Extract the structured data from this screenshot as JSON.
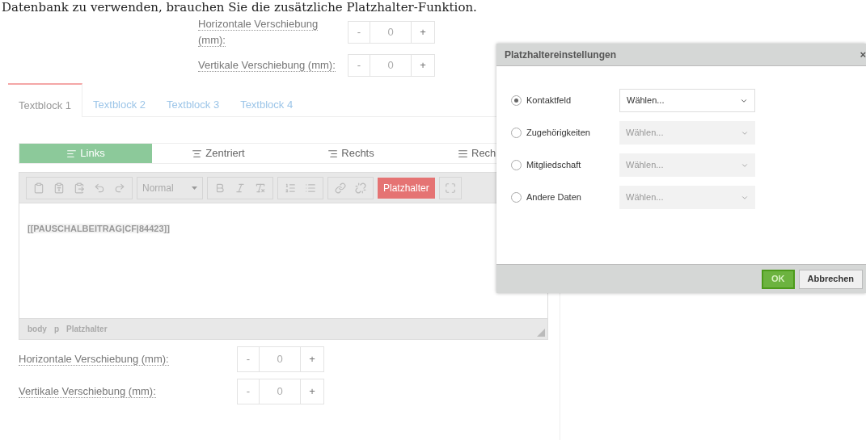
{
  "intro_text": "Datenbank zu verwenden, brauchen Sie die zusätzliche Platzhalter-Funktion.",
  "top_offsets": [
    {
      "label": "Horizontale Verschiebung (mm):",
      "minus": "-",
      "value": "0",
      "plus": "+"
    },
    {
      "label": "Vertikale Verschiebung (mm):",
      "minus": "-",
      "value": "0",
      "plus": "+"
    }
  ],
  "tabs": [
    {
      "label": "Textblock 1",
      "selected": true
    },
    {
      "label": "Textblock 2",
      "selected": false
    },
    {
      "label": "Textblock 3",
      "selected": false
    },
    {
      "label": "Textblock 4",
      "selected": false
    }
  ],
  "alignment": [
    {
      "label": "Links",
      "kind": "left",
      "selected": true
    },
    {
      "label": "Zentriert",
      "kind": "center",
      "selected": false
    },
    {
      "label": "Rechts",
      "kind": "right",
      "selected": false
    },
    {
      "label": "Rech",
      "kind": "justify",
      "selected": false
    }
  ],
  "toolbar": {
    "format": "Normal",
    "placeholder_button": "Platzhalter"
  },
  "editor": {
    "content": "[[PAUSCHALBEITRAG|CF|84423]]",
    "path": [
      "body",
      "p",
      "Platzhalter"
    ]
  },
  "offsets": [
    {
      "label": "Horizontale Verschiebung (mm):",
      "minus": "-",
      "value": "0",
      "plus": "+"
    },
    {
      "label": "Vertikale Verschiebung (mm):",
      "minus": "-",
      "value": "0",
      "plus": "+"
    }
  ],
  "dialog": {
    "title": "Platzhaltereinstellungen",
    "close": "×",
    "options": [
      {
        "label": "Kontaktfeld",
        "selected": true,
        "select": "Wählen..."
      },
      {
        "label": "Zugehörigkeiten",
        "selected": false,
        "select": "Wählen..."
      },
      {
        "label": "Mitgliedschaft",
        "selected": false,
        "select": "Wählen..."
      },
      {
        "label": "Andere Daten",
        "selected": false,
        "select": "Wählen..."
      }
    ],
    "ok": "OK",
    "cancel": "Abbrechen"
  }
}
